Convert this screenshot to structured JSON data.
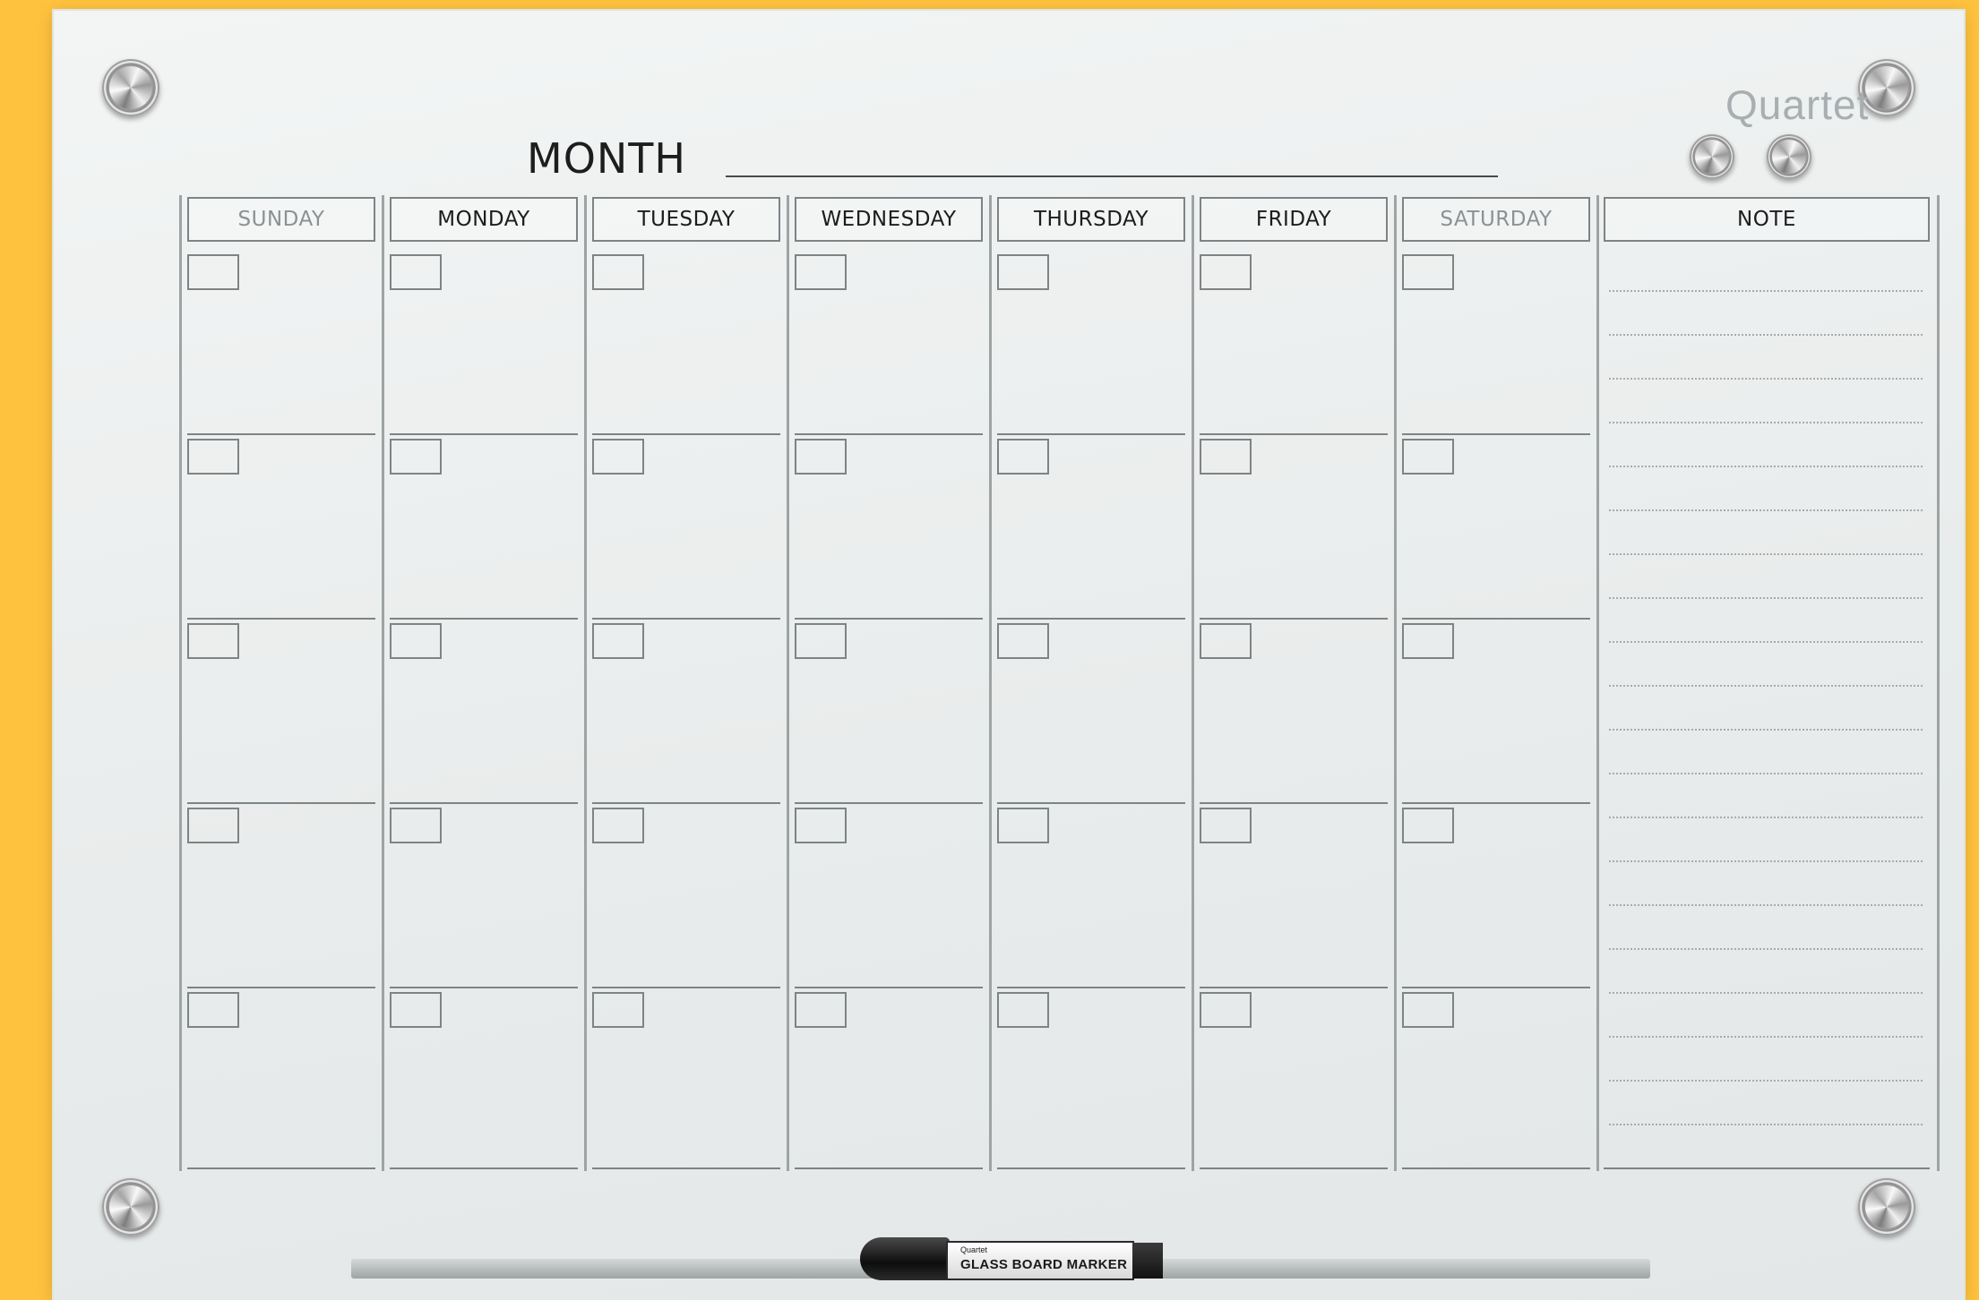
{
  "board": {
    "brand": "Quartet",
    "month_label": "MONTH",
    "days": [
      "SUNDAY",
      "MONDAY",
      "TUESDAY",
      "WEDNESDAY",
      "THURSDAY",
      "FRIDAY",
      "SATURDAY"
    ],
    "weekend_days": [
      "SUNDAY",
      "SATURDAY"
    ],
    "note_label": "NOTE",
    "weeks": 5,
    "note_line_count": 20
  },
  "marker": {
    "brand": "Quartet",
    "label": "GLASS BOARD MARKER"
  },
  "colors": {
    "background": "#ffc23e",
    "board": "#eef1f1",
    "grid_lines": "#7e8385",
    "weekend_text": "#8c9193",
    "brand_text": "#a9aeb0"
  }
}
